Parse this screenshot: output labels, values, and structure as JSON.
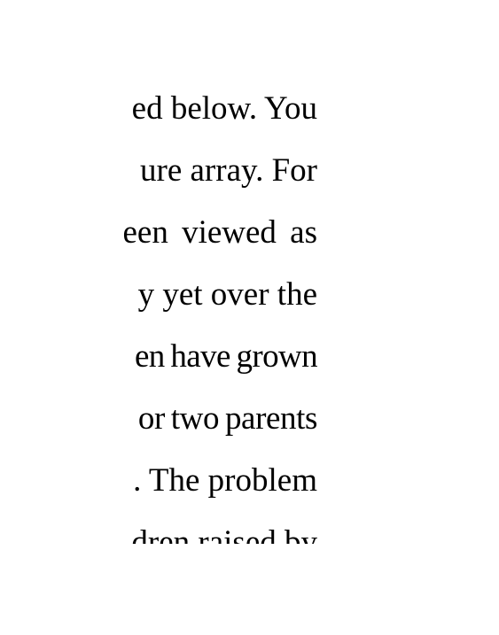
{
  "document": {
    "lines": [
      "ed below. You",
      "ure array. For",
      "een viewed as",
      "y yet over the",
      "en have grown",
      "or two parents",
      ". The problem",
      "dren raised by"
    ]
  }
}
